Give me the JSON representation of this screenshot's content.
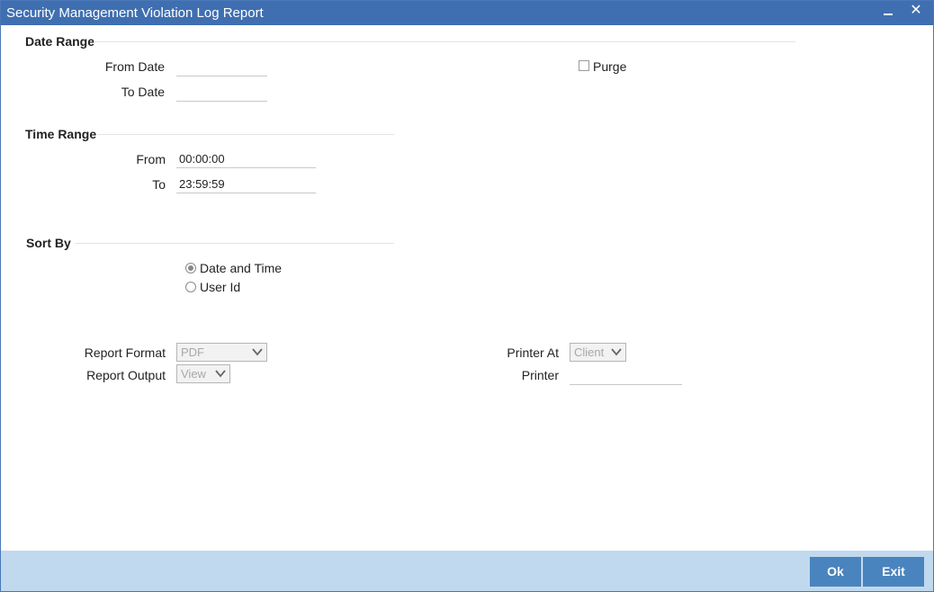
{
  "window": {
    "title": "Security Management Violation Log Report"
  },
  "date_range": {
    "title": "Date Range",
    "from_label": "From Date",
    "from_value": "",
    "to_label": "To Date",
    "to_value": "",
    "purge_label": "Purge",
    "purge_checked": false
  },
  "time_range": {
    "title": "Time Range",
    "from_label": "From",
    "from_value": "00:00:00",
    "to_label": "To",
    "to_value": "23:59:59"
  },
  "sort_by": {
    "title": "Sort By",
    "options": [
      {
        "label": "Date and Time",
        "selected": true
      },
      {
        "label": "User Id",
        "selected": false
      }
    ]
  },
  "report": {
    "format_label": "Report Format",
    "format_value": "PDF",
    "output_label": "Report Output",
    "output_value": "View",
    "printer_at_label": "Printer At",
    "printer_at_value": "Client",
    "printer_label": "Printer",
    "printer_value": ""
  },
  "footer": {
    "ok_label": "Ok",
    "exit_label": "Exit"
  },
  "colors": {
    "titlebar": "#3f6fb0",
    "footer": "#c1d9ee",
    "button": "#4a84be"
  }
}
